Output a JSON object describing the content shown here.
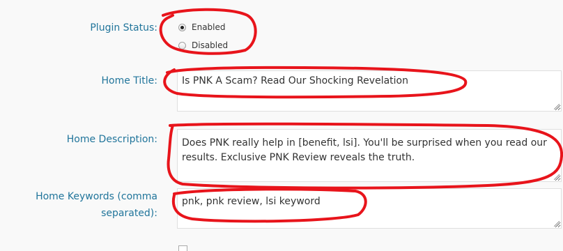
{
  "plugin_status": {
    "label": "Plugin Status:",
    "options": [
      "Enabled",
      "Disabled"
    ],
    "selected": "Enabled"
  },
  "home_title": {
    "label": "Home Title:",
    "value": "Is PNK A Scam? Read Our Shocking Revelation"
  },
  "home_description": {
    "label": "Home Description:",
    "value": "Does PNK really help in [benefit, lsi]. You'll be surprised when you read our results. Exclusive PNK Review reveals the truth."
  },
  "home_keywords": {
    "label_line1": "Home Keywords (comma",
    "label_line2": "separated):",
    "value": "pnk, pnk review, lsi keyword"
  },
  "annotation_color": "#e8141b"
}
